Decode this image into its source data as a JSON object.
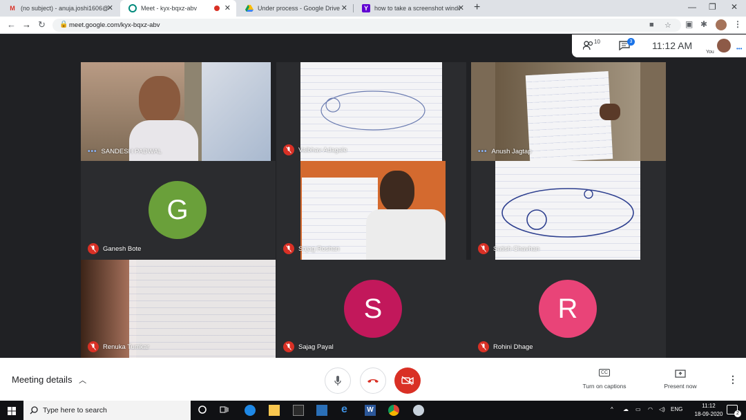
{
  "browser": {
    "tabs": [
      {
        "title": "(no subject) - anuja.joshi1606@g",
        "icon": "gmail-icon"
      },
      {
        "title": "Meet - kyx-bqxz-abv",
        "icon": "meet-icon",
        "active": true,
        "recording": true
      },
      {
        "title": "Under process - Google Drive",
        "icon": "drive-icon"
      },
      {
        "title": "how to take a screenshot windo",
        "icon": "yahoo-icon"
      }
    ],
    "new_tab": "+",
    "url": "meet.google.com/kyx-bqxz-abv"
  },
  "meet": {
    "participants_count": "10",
    "chat_count": "3",
    "time": "11:12 AM",
    "you_label": "You",
    "tiles": [
      {
        "name": "SANDESH PADWAL",
        "state": "talking"
      },
      {
        "name": "Vaibhav Adagale",
        "state": "muted"
      },
      {
        "name": "Anush Jagtap",
        "state": "talking"
      },
      {
        "name": "Ganesh Bote",
        "state": "muted",
        "initial": "G",
        "color": "#6aa03a"
      },
      {
        "name": "Sajag Roshan",
        "state": "muted"
      },
      {
        "name": "Satish Chavhan",
        "state": "muted"
      },
      {
        "name": "Renuka Tumkar",
        "state": "muted"
      },
      {
        "name": "Sajag Payal",
        "state": "muted",
        "initial": "S",
        "color": "#c2185b"
      },
      {
        "name": "Rohini Dhage",
        "state": "muted",
        "initial": "R",
        "color": "#e94478"
      }
    ],
    "bottom": {
      "meeting_details": "Meeting details",
      "captions_label": "Turn on captions",
      "captions_icon": "CC",
      "present_label": "Present now"
    }
  },
  "taskbar": {
    "search_placeholder": "Type here to search",
    "language": "ENG",
    "time": "11:12",
    "date": "18-09-2020",
    "notification_count": "2"
  },
  "colors": {
    "accent": "#1a73e8",
    "danger": "#d93025",
    "stage_bg": "#202124"
  }
}
